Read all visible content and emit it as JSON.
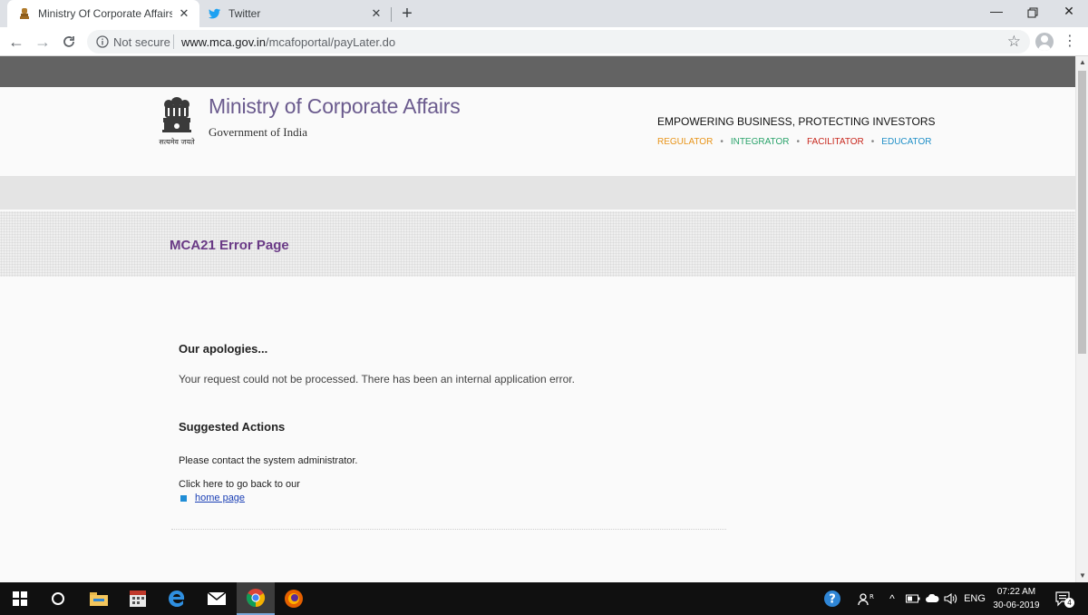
{
  "browser": {
    "tabs": [
      {
        "title": "Ministry Of Corporate Affairs - M",
        "icon": "emblem-favicon",
        "active": true
      },
      {
        "title": "Twitter",
        "icon": "twitter-bird-icon",
        "active": false
      }
    ],
    "security_label": "Not secure",
    "url_domain": "www.mca.gov.in",
    "url_path": "/mcafoportal/payLater.do"
  },
  "header": {
    "ministry_name": "Ministry of Corporate Affairs",
    "government": "Government of India",
    "emblem_motto": "सत्यमेव जयते",
    "tagline": "EMPOWERING BUSINESS, PROTECTING INVESTORS",
    "roles": [
      {
        "label": "REGULATOR",
        "color": "#e8941a"
      },
      {
        "label": "INTEGRATOR",
        "color": "#2aa36b"
      },
      {
        "label": "FACILITATOR",
        "color": "#c8281e"
      },
      {
        "label": "EDUCATOR",
        "color": "#1f8fc7"
      }
    ],
    "role_separator": "•"
  },
  "page": {
    "title": "MCA21 Error Page",
    "apologies_heading": "Our apologies...",
    "error_message": "Your request could not be processed. There has been an internal application error.",
    "suggested_heading": "Suggested Actions",
    "contact_text": "Please contact the system administrator.",
    "go_back_text": "Click here to go back to our",
    "home_link": "home page"
  },
  "taskbar": {
    "apps": [
      "start-icon",
      "cortana-icon",
      "file-explorer-icon",
      "calendar-icon",
      "edge-icon",
      "mail-icon",
      "chrome-icon",
      "firefox-icon"
    ],
    "language": "ENG",
    "time": "07:22 AM",
    "date": "30-06-2019",
    "notification_count": "4"
  },
  "colors": {
    "accent_purple": "#6a3a86",
    "link_blue": "#1a3fb5"
  }
}
